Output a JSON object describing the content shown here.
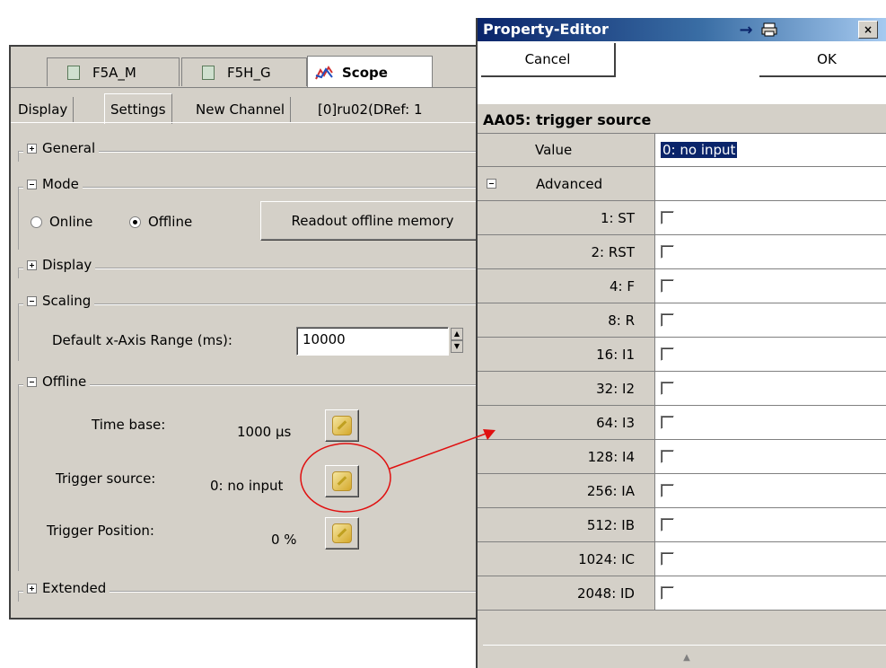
{
  "scope_panel": {
    "doc_tabs": [
      {
        "label": "F5A_M",
        "icon": "module-icon"
      },
      {
        "label": "F5H_G",
        "icon": "module-icon"
      },
      {
        "label": "Scope",
        "icon": "scope-icon"
      }
    ],
    "sub_tabs": [
      "Display",
      "Settings",
      "New Channel",
      "[0]ru02(DRef: 1"
    ],
    "groups": {
      "general": "General",
      "mode": "Mode",
      "display": "Display",
      "scaling": "Scaling",
      "offline": "Offline",
      "extended": "Extended"
    },
    "mode": {
      "online_label": "Online",
      "offline_label": "Offline",
      "selected": "Offline",
      "readout_button": "Readout offline memory"
    },
    "scaling": {
      "x_range_label": "Default x-Axis Range (ms):",
      "x_range_value": "10000"
    },
    "offline": {
      "time_base_label": "Time base:",
      "time_base_value": "1000 µs",
      "trigger_source_label": "Trigger source:",
      "trigger_source_value": "0: no input",
      "trigger_position_label": "Trigger Position:",
      "trigger_position_value": "0 %"
    }
  },
  "property_editor": {
    "title": "Property-Editor",
    "cancel_label": "Cancel",
    "ok_label": "OK",
    "heading": "AA05: trigger source",
    "value_label": "Value",
    "value": "0: no input",
    "advanced_label": "Advanced",
    "flags": [
      {
        "label": "1: ST",
        "checked": false
      },
      {
        "label": "2: RST",
        "checked": false
      },
      {
        "label": "4: F",
        "checked": false
      },
      {
        "label": "8: R",
        "checked": false
      },
      {
        "label": "16: I1",
        "checked": false
      },
      {
        "label": "32: I2",
        "checked": false
      },
      {
        "label": "64: I3",
        "checked": false
      },
      {
        "label": "128: I4",
        "checked": false
      },
      {
        "label": "256: IA",
        "checked": false
      },
      {
        "label": "512: IB",
        "checked": false
      },
      {
        "label": "1024: IC",
        "checked": false
      },
      {
        "label": "2048: ID",
        "checked": false
      }
    ]
  },
  "colors": {
    "panel": "#d4d0c8",
    "titlebar": "#0a246a",
    "annotation": "#e01010"
  }
}
